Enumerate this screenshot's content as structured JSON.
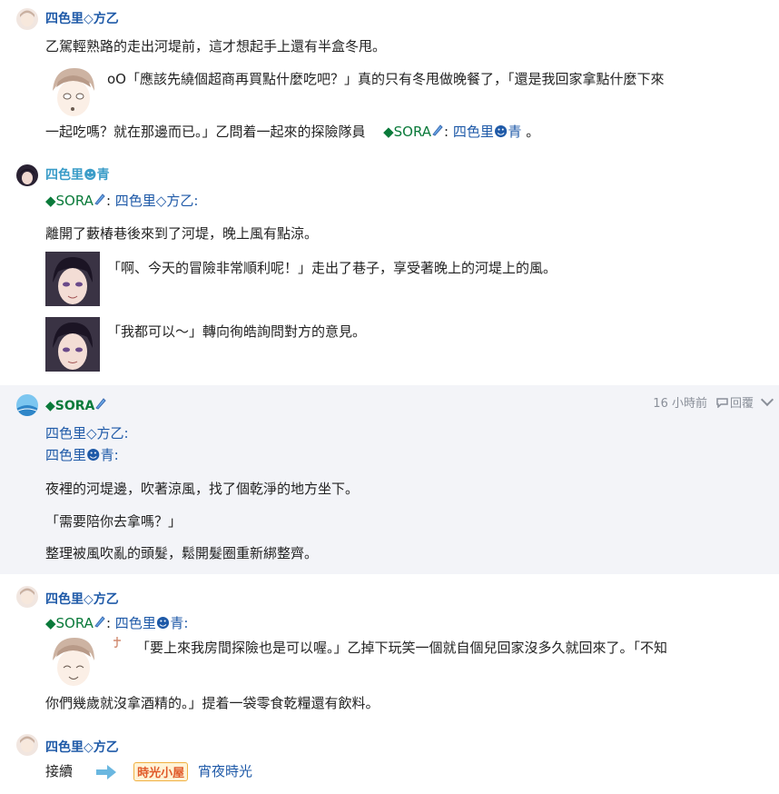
{
  "posts": [
    {
      "user": "四色里◇方乙",
      "line1": "乙駕輕熟路的走出河堤前，這才想起手上還有半盒冬甩。",
      "line2": "oO「應該先繞個超商再買點什麼吃吧？」真的只有冬甩做晚餐了，「還是我回家拿點什麼下來",
      "line3_a": "一起吃嗎？就在那邊而已。」乙問着一起來的探險隊員",
      "mention_sora": "◆SORA",
      "mention_sep": ":",
      "mention_ao": "四色里☻青",
      "line3_end": "。"
    },
    {
      "user": "四色里☻青",
      "mention_sora": "◆SORA",
      "mention_sep": ":",
      "mention_otsu": "四色里◇方乙:",
      "line1": "離開了藪椿巷後來到了河堤，晚上風有點涼。",
      "line2": "「啊、今天的冒險非常順利呢！」走出了巷子，享受著晚上的河堤上的風。",
      "line3": "「我都可以～」轉向徇皓詢問對方的意見。"
    },
    {
      "user": "◆SORA",
      "time": "16 小時前",
      "reply": "回覆",
      "mention_otsu": "四色里◇方乙:",
      "mention_ao": "四色里☻青:",
      "line1": "夜裡的河堤邊，吹著涼風，找了個乾淨的地方坐下。",
      "line2": "「需要陪你去拿嗎？」",
      "line3": "整理被風吹亂的頭髮，鬆開髮圈重新綁整齊。"
    },
    {
      "user": "四色里◇方乙",
      "mention_sora": "◆SORA",
      "mention_sep": ":",
      "mention_ao": "四色里☻青:",
      "line1": "「要上來我房間探險也是可以喔。」乙掉下玩笑一個就自個兒回家沒多久就回來了。「不知",
      "line2": "你們幾歲就沒拿酒精的。」提着一袋零食乾糧還有飲料。"
    },
    {
      "user": "四色里◇方乙",
      "continue": "接續",
      "logo": "時光小屋",
      "link": "宵夜時光"
    }
  ],
  "icons": {
    "arrow": "arrow-right-icon",
    "pen": "pen-icon",
    "reply": "reply-icon",
    "chevron": "chevron-down-icon"
  },
  "colors": {
    "link_blue": "#1f5aa8",
    "sora_green": "#0a7a3a",
    "highlight_bg": "#f3f4f8"
  }
}
